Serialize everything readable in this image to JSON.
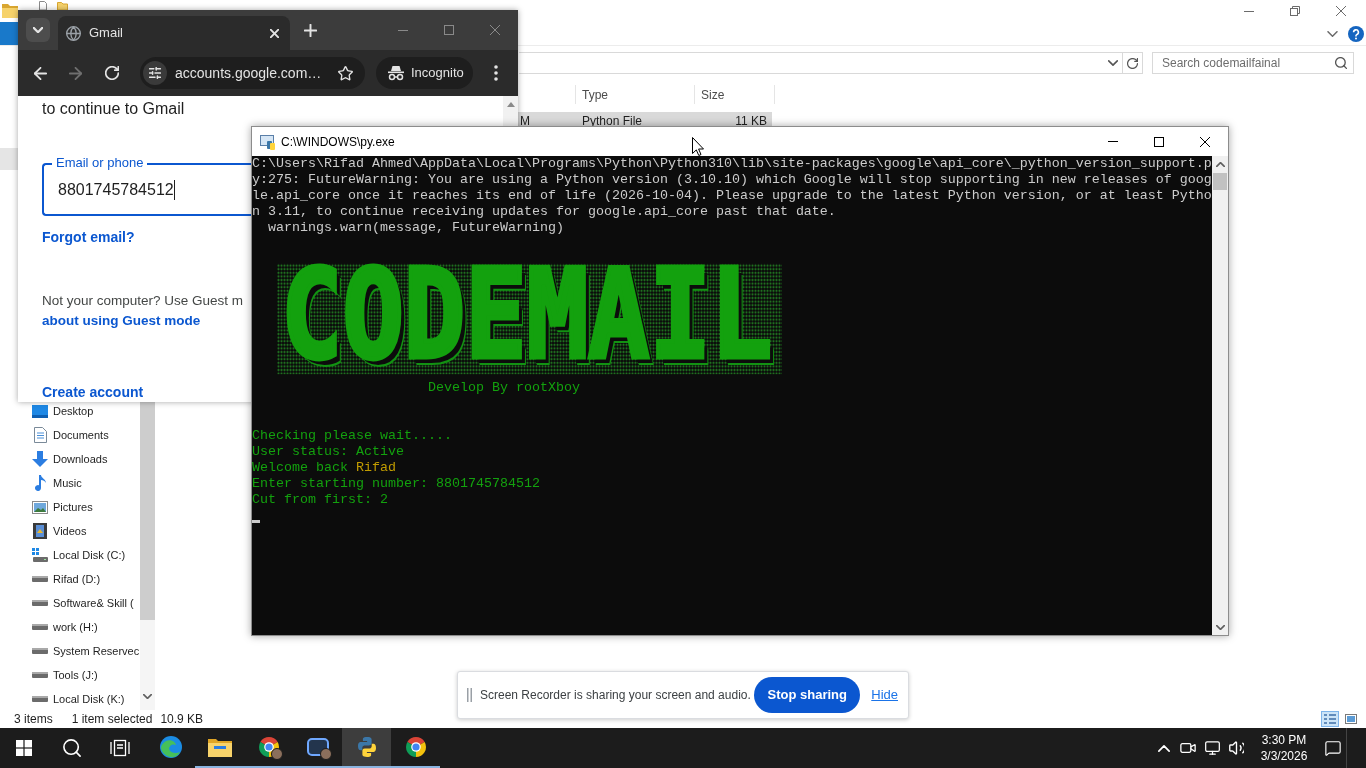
{
  "explorer": {
    "search": {
      "placeholder": "Search codemailfainal"
    },
    "columns": [
      "",
      "Type",
      "Size"
    ],
    "rows": [
      {
        "cells": [
          "M",
          "Python File",
          "11 KB"
        ],
        "selected": true
      }
    ],
    "nav_items": [
      {
        "label": "Desktop",
        "kind": "desktop"
      },
      {
        "label": "Documents",
        "kind": "documents"
      },
      {
        "label": "Downloads",
        "kind": "downloads"
      },
      {
        "label": "Music",
        "kind": "music"
      },
      {
        "label": "Pictures",
        "kind": "pictures"
      },
      {
        "label": "Videos",
        "kind": "videos"
      },
      {
        "label": "Local Disk (C:)",
        "kind": "system_drive"
      },
      {
        "label": "Rifad (D:)",
        "kind": "drive"
      },
      {
        "label": "Software& Skill (",
        "kind": "drive"
      },
      {
        "label": "work (H:)",
        "kind": "drive"
      },
      {
        "label": "System Reservec",
        "kind": "drive"
      },
      {
        "label": "Tools (J:)",
        "kind": "drive"
      },
      {
        "label": "Local Disk (K:)",
        "kind": "drive"
      }
    ],
    "status_bar": {
      "item_count": "3 items",
      "selection": "1 item selected",
      "selection_size": "10.9 KB"
    },
    "view_buttons": [
      {
        "kind": "details",
        "selected": true
      },
      {
        "kind": "large_icons",
        "selected": false
      }
    ]
  },
  "browser": {
    "tab_title": "Gmail",
    "nav_buttons": [
      {
        "kind": "back",
        "disabled": false
      },
      {
        "kind": "forward",
        "disabled": true
      },
      {
        "kind": "reload",
        "disabled": false
      }
    ],
    "address": "accounts.google.com…",
    "profile_chip": "Incognito",
    "page": {
      "subtitle": "to continue to Gmail",
      "email_field": {
        "label": "Email or phone",
        "value": "8801745784512",
        "focused": true
      },
      "forgot_link": "Forgot email?",
      "guest_note": "Not your computer? Use Guest m",
      "guest_link": "about using Guest mode",
      "create_account_link": "Create account"
    }
  },
  "console": {
    "title": "C:\\WINDOWS\\py.exe",
    "warning_lines": [
      "C:\\Users\\Rifad Ahmed\\AppData\\Local\\Programs\\Python\\Python310\\lib\\site-packages\\google\\api_core\\_python_version_support.p",
      "y:275: FutureWarning: You are using a Python version (3.10.10) which Google will stop supporting in new releases of goog",
      "le.api_core once it reaches its end of life (2026-10-04). Please upgrade to the latest Python version, or at least Pytho",
      "n 3.11, to continue receiving updates for google.api_core past that date."
    ],
    "source_line": "warnings.warn(message, FutureWarning)",
    "banner": "CODEMAIL",
    "credit": "Develop By rootXboy",
    "output_lines": [
      {
        "segments": [
          {
            "text": "Checking please wait.....",
            "color": "#13a10e"
          }
        ]
      },
      {
        "segments": [
          {
            "text": "User status: Active",
            "color": "#13a10e"
          }
        ]
      },
      {
        "segments": [
          {
            "text": "Welcome back ",
            "color": "#13a10e"
          },
          {
            "text": "Rifad",
            "color": "#c19c00"
          }
        ]
      },
      {
        "segments": [
          {
            "text": "Enter starting number: 8801745784512",
            "color": "#13a10e"
          }
        ]
      },
      {
        "segments": [
          {
            "text": "Cut from first: 2",
            "color": "#13a10e"
          }
        ]
      }
    ]
  },
  "share_bar": {
    "message": "Screen Recorder is sharing your screen and audio.",
    "stop_button": "Stop sharing",
    "hide_link": "Hide"
  },
  "taskbar": {
    "apps": [
      {
        "kind": "edge",
        "running": false,
        "selected": false
      },
      {
        "kind": "file_explorer",
        "running": true,
        "selected": false
      },
      {
        "kind": "chrome_profile",
        "running": true,
        "selected": false
      },
      {
        "kind": "app_profile",
        "running": true,
        "selected": false
      },
      {
        "kind": "python",
        "running": true,
        "selected": true
      },
      {
        "kind": "chrome",
        "running": true,
        "selected": false
      }
    ],
    "clock": {
      "time": "3:30 PM",
      "date": "3/3/2026"
    }
  }
}
